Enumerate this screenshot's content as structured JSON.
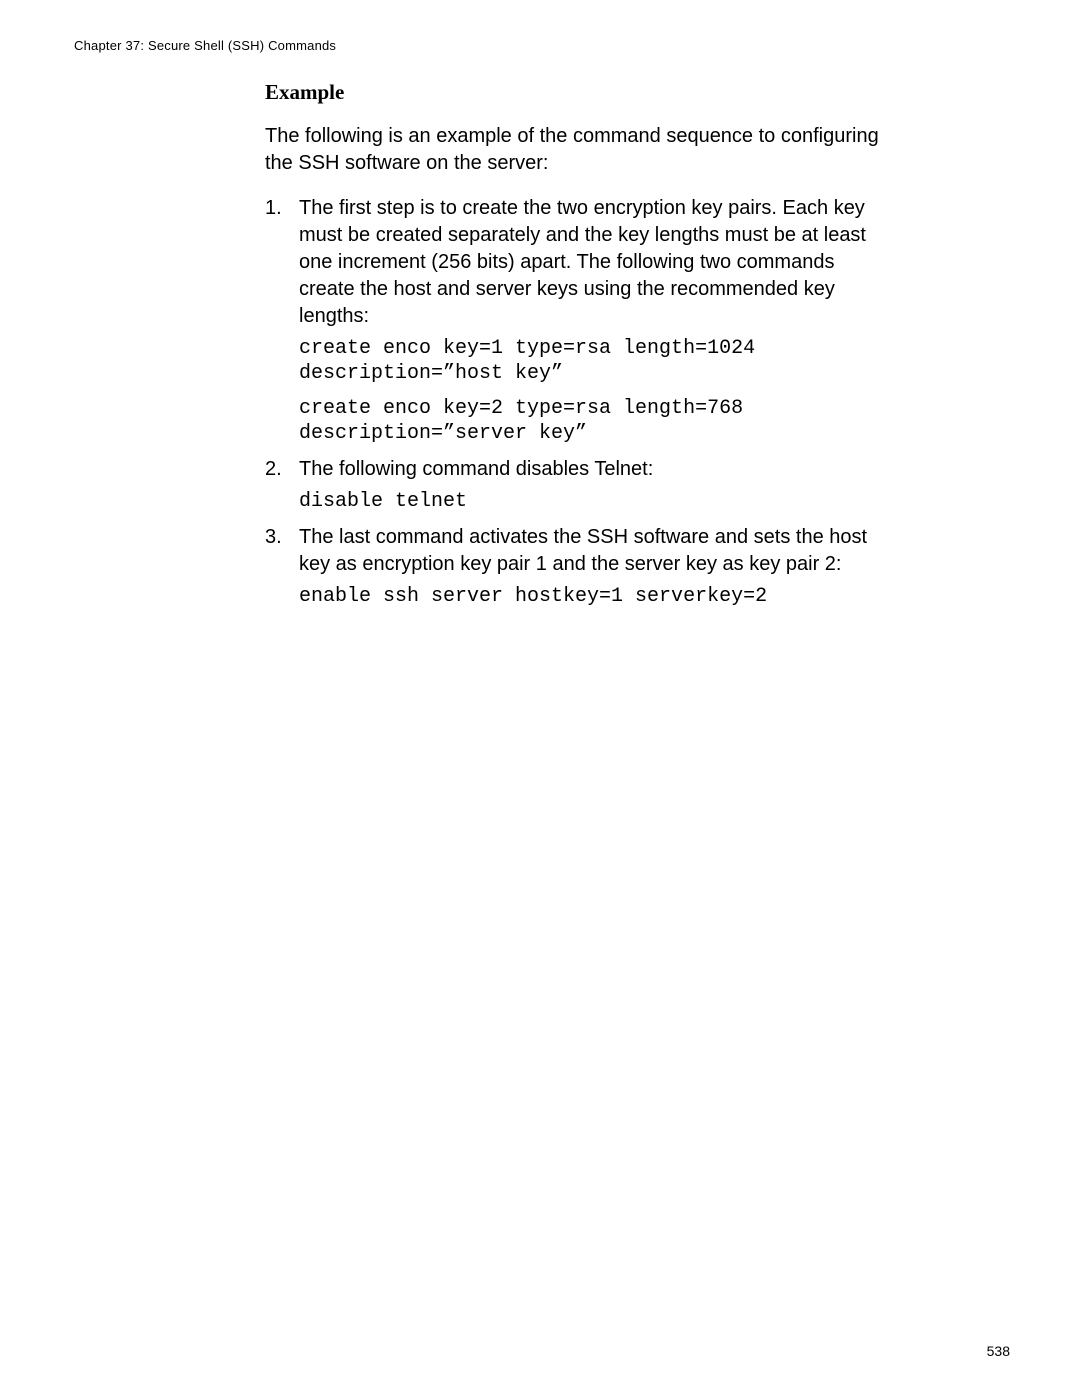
{
  "header": {
    "chapter": "Chapter 37: Secure Shell (SSH) Commands"
  },
  "section": {
    "title": "Example",
    "intro": "The following is an example of the command sequence to configuring the SSH software on the server:"
  },
  "steps": [
    {
      "text": "The first step is to create the two encryption key pairs. Each key must be created separately and the key lengths must be at least one increment (256 bits) apart. The following two commands create the host and server keys using the recommended key lengths:",
      "code": [
        "create enco key=1 type=rsa length=1024 description=”host key”",
        "create enco key=2 type=rsa length=768 description=”server key”"
      ]
    },
    {
      "text": "The following command disables Telnet:",
      "code": [
        "disable telnet"
      ]
    },
    {
      "text": "The last command activates the SSH software and sets the host key as encryption key pair 1 and the server key as key pair 2:",
      "code": [
        "enable ssh server hostkey=1 serverkey=2"
      ]
    }
  ],
  "page_number": "538"
}
